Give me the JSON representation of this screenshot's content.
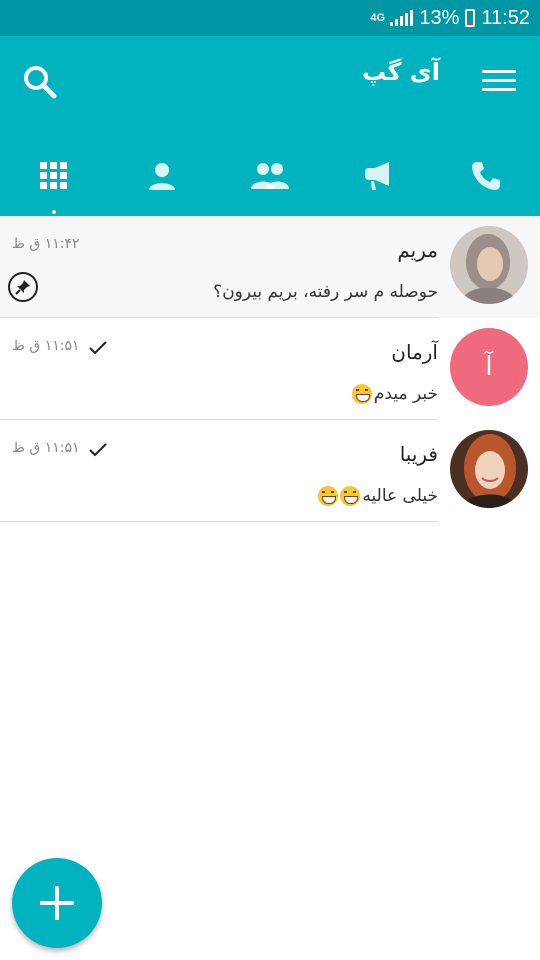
{
  "status_bar": {
    "network": "4G",
    "battery_percent": "13%",
    "battery_level": 0.13,
    "time": "11:52"
  },
  "app_bar": {
    "title": "آی گپ",
    "search_icon": "search-icon",
    "menu_icon": "menu-icon"
  },
  "tabs": [
    {
      "icon": "grid-icon",
      "active": true
    },
    {
      "icon": "person-icon",
      "active": false
    },
    {
      "icon": "group-icon",
      "active": false
    },
    {
      "icon": "megaphone-icon",
      "active": false
    },
    {
      "icon": "phone-icon",
      "active": false
    }
  ],
  "chats": [
    {
      "name": "مریم",
      "preview": "حوصله م سر رفته، بریم بیرون؟",
      "time": "۱۱:۴۲ ق ظ",
      "pinned": true,
      "sent_check": false,
      "avatar": "photo",
      "emoji_count": 0
    },
    {
      "name": "آرمان",
      "preview": "خبر میدم",
      "time": "۱۱:۵۱ ق ظ",
      "pinned": false,
      "sent_check": true,
      "avatar_letter": "آ",
      "emoji_count": 1
    },
    {
      "name": "فریبا",
      "preview": "خیلی عالیه",
      "time": "۱۱:۵۱ ق ظ",
      "pinned": false,
      "sent_check": true,
      "avatar": "photo",
      "emoji_count": 2
    }
  ],
  "colors": {
    "status_bar": "#0096a3",
    "app_bar": "#00b3be",
    "tab_icon": "#ffffff",
    "letter_avatar": "#f06a7d",
    "fab": "#00b3be"
  }
}
